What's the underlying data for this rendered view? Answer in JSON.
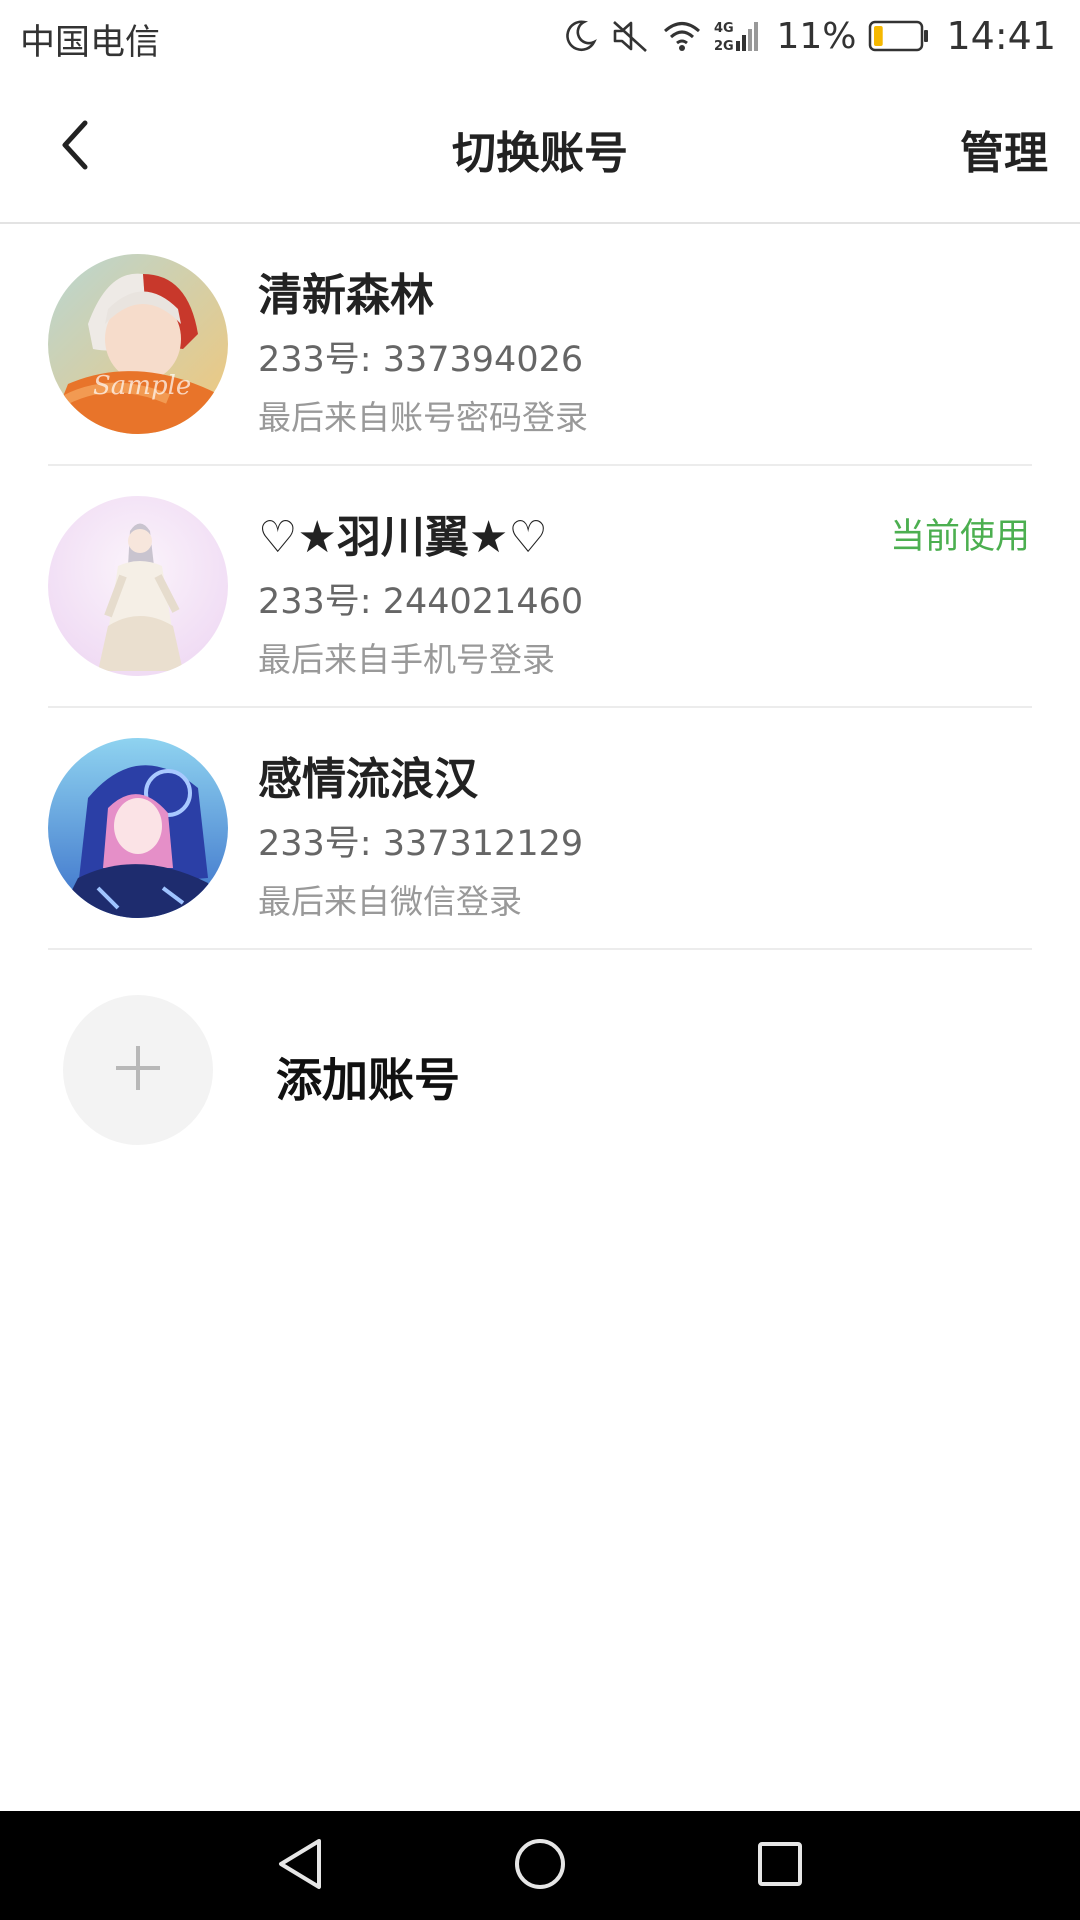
{
  "status_bar": {
    "carrier": "中国电信",
    "network": "4G 2G",
    "battery_percent": "11%",
    "battery_level": 0.11,
    "time": "14:41",
    "icons": [
      "moon-icon",
      "mute-icon",
      "wifi-icon",
      "signal-icon",
      "battery-icon"
    ]
  },
  "header": {
    "title": "切换账号",
    "back_icon": "chevron-left-icon",
    "manage_label": "管理"
  },
  "accounts": [
    {
      "name": "清新森林",
      "id_text": "233号: 337394026",
      "login_text": "最后来自账号密码登录",
      "badge": ""
    },
    {
      "name": "♡★羽川翼★♡",
      "id_text": "233号: 244021460",
      "login_text": "最后来自手机号登录",
      "badge": "当前使用"
    },
    {
      "name": "感情流浪汉",
      "id_text": "233号: 337312129",
      "login_text": "最后来自微信登录",
      "badge": ""
    }
  ],
  "add_account": {
    "label": "添加账号",
    "icon": "plus-icon"
  },
  "nav_bar": {
    "icons": [
      "nav-back-icon",
      "nav-home-icon",
      "nav-recents-icon"
    ]
  },
  "colors": {
    "accent_green": "#4caf50",
    "battery_fill": "#f5b800",
    "divider": "#ececec"
  }
}
